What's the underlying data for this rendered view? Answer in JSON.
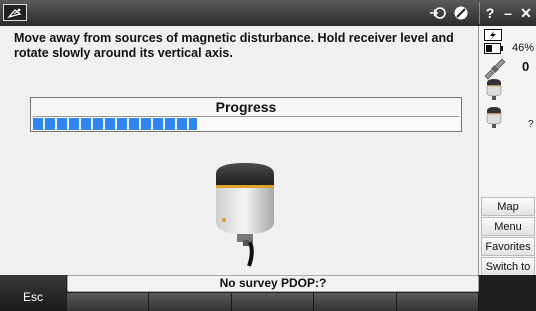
{
  "instructions": "Move away from sources of magnetic disturbance. Hold receiver level and rotate slowly around its vertical axis.",
  "progress": {
    "label": "Progress",
    "fraction": 0.385
  },
  "titlebar": {
    "help_label": "?",
    "minimize_label": "–",
    "close_label": "✕"
  },
  "status": {
    "battery_percent": "46%",
    "satellites": "0",
    "receiver_unknown": "?"
  },
  "side_buttons": [
    "Map",
    "Menu",
    "Favorites",
    "Switch to"
  ],
  "status_bar": {
    "text": "No survey  PDOP:?"
  },
  "bottom": {
    "esc_label": "Esc"
  },
  "colors": {
    "progress_fill": "#2f86ef",
    "titlebar": "#3a3a3a"
  }
}
